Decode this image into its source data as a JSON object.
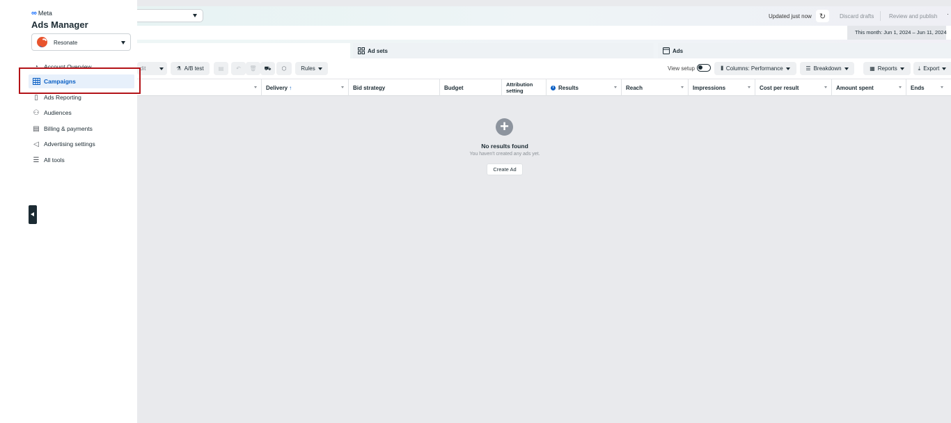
{
  "sidebar": {
    "brand": "Meta",
    "app_title": "Ads Manager",
    "account_name": "Resonate",
    "items": [
      {
        "label": "Account Overview",
        "icon": "gauge-icon"
      },
      {
        "label": "Campaigns",
        "icon": "table-icon",
        "active": true
      },
      {
        "label": "Ads Reporting",
        "icon": "report-icon"
      },
      {
        "label": "Audiences",
        "icon": "people-icon"
      },
      {
        "label": "Billing & payments",
        "icon": "billing-icon"
      },
      {
        "label": "Advertising settings",
        "icon": "megaphone-icon"
      },
      {
        "label": "All tools",
        "icon": "menu-icon"
      }
    ]
  },
  "topbar": {
    "updated": "Updated just now",
    "discard": "Discard drafts",
    "review": "Review and publish",
    "date_range": "This month: Jun 1, 2024 – Jun 11, 2024"
  },
  "tabs": {
    "adsets": "Ad sets",
    "ads": "Ads"
  },
  "toolbar": {
    "edit": "dit",
    "ab_test": "A/B test",
    "rules": "Rules",
    "view_setup": "View setup",
    "columns": "Columns: Performance",
    "breakdown": "Breakdown",
    "reports": "Reports",
    "export": "Export"
  },
  "columns": {
    "delivery": "Delivery",
    "bid_strategy": "Bid strategy",
    "budget": "Budget",
    "attribution_1": "Attribution",
    "attribution_2": "setting",
    "results": "Results",
    "reach": "Reach",
    "impressions": "Impressions",
    "cost_per_result": "Cost per result",
    "amount_spent": "Amount spent",
    "ends": "Ends"
  },
  "empty_state": {
    "title": "No results found",
    "subtitle": "You haven't created any ads yet.",
    "button": "Create Ad"
  },
  "colors": {
    "accent": "#0a5fc4",
    "highlight": "#b31217"
  }
}
